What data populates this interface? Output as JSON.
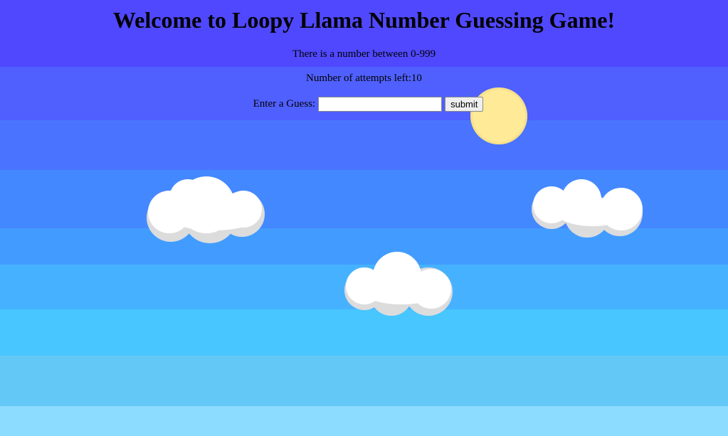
{
  "game": {
    "title": "Welcome to Loopy Llama Number Guessing Game!",
    "range_text": "There is a number between 0-999",
    "attempts_text": "Number of attempts left:10",
    "guess_label": "Enter a Guess:",
    "guess_value": "",
    "submit_label": "submit"
  },
  "scene": {
    "sun_color": "#ffea98",
    "cloud_color": "#ffffff",
    "cloud_shadow_color": "#dcdcdc",
    "sky_colors": [
      "#5048ff",
      "#5060ff",
      "#4a74ff",
      "#4488ff",
      "#429cff",
      "#46b2ff",
      "#48c6ff",
      "#64c8f6",
      "#8cdcff"
    ]
  }
}
